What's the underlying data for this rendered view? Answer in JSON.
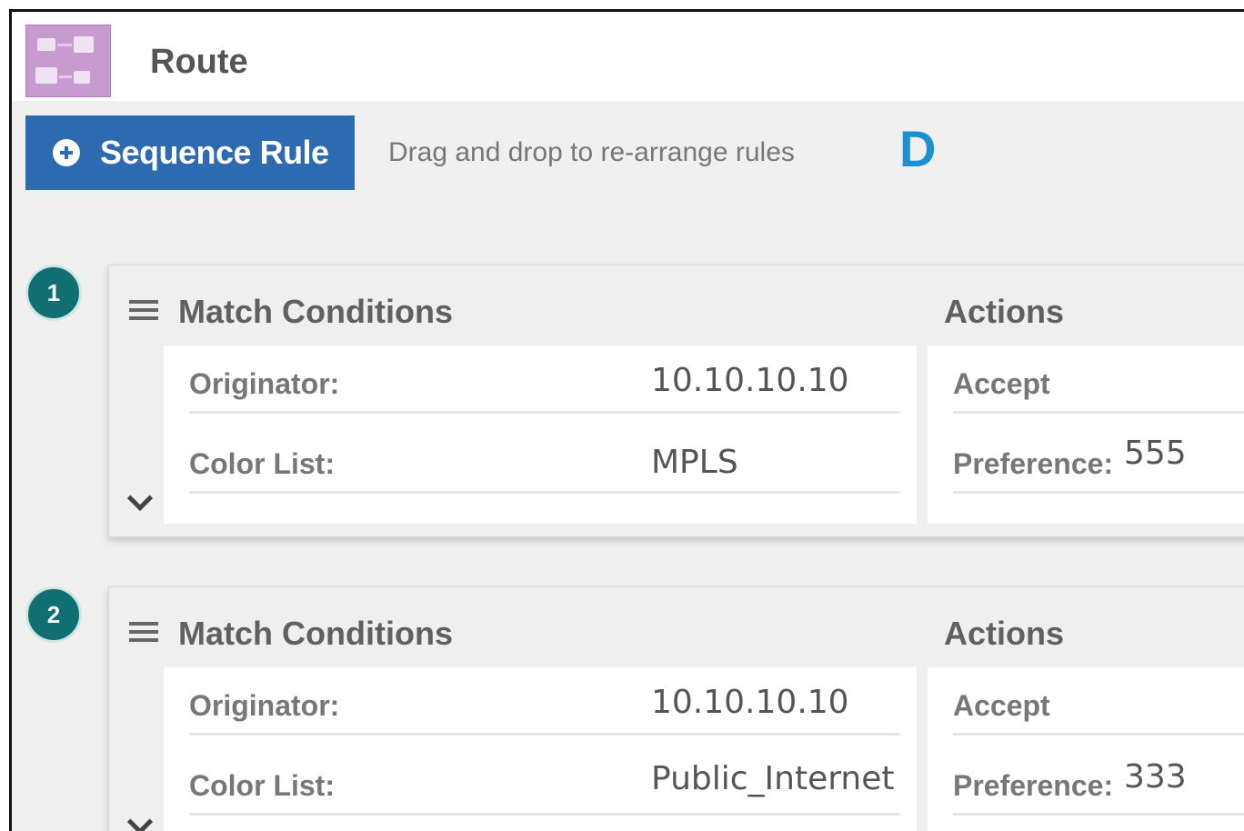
{
  "header": {
    "icon": "route-policy-icon",
    "title": "Route"
  },
  "toolbar": {
    "sequence_rule_label": "Sequence Rule",
    "drag_hint": "Drag and drop to re-arrange rules",
    "marker_letter": "D"
  },
  "rules": [
    {
      "number": "1",
      "match_title": "Match Conditions",
      "actions_title": "Actions",
      "originator_label": "Originator:",
      "originator_value": "10.10.10.10",
      "color_list_label": "Color List:",
      "color_list_value": "MPLS",
      "action": "Accept",
      "preference_label": "Preference:",
      "preference_value": "555"
    },
    {
      "number": "2",
      "match_title": "Match Conditions",
      "actions_title": "Actions",
      "originator_label": "Originator:",
      "originator_value": "10.10.10.10",
      "color_list_label": "Color List:",
      "color_list_value": "Public_Internet",
      "action": "Accept",
      "preference_label": "Preference:",
      "preference_value": "333"
    }
  ],
  "colors": {
    "primary_button": "#2d6ab0",
    "badge": "#0f6f72",
    "marker_letter": "#1e90d2",
    "app_icon": "#c79ad0"
  }
}
